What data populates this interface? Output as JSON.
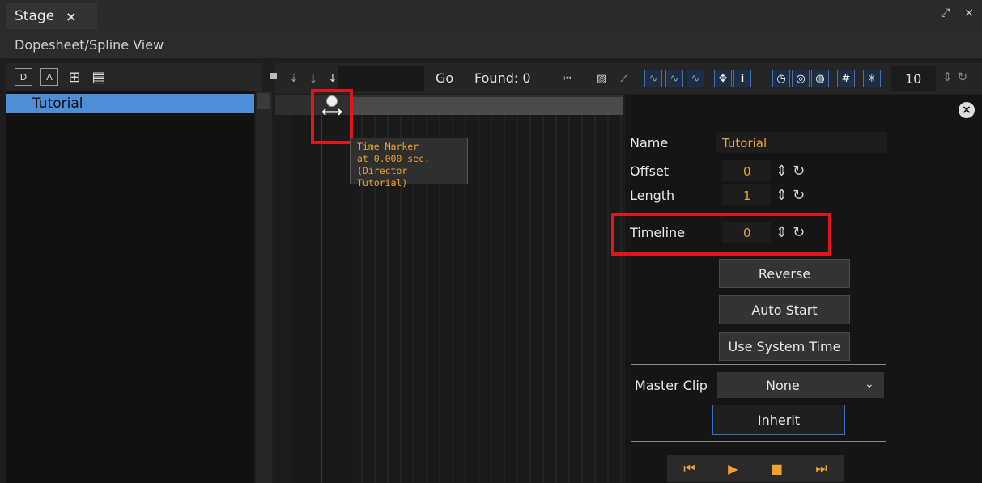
{
  "tabs": {
    "stage_label": "Stage",
    "close_label": "×"
  },
  "window_controls": {
    "maximize": "⤢",
    "close": "×"
  },
  "subtitle": "Dopesheet/Spline View",
  "left_toolbar": {
    "icons": [
      "new-director-icon",
      "new-actor-icon",
      "add-keyframe-icon",
      "save-icon"
    ]
  },
  "tree": {
    "items": [
      {
        "label": "Tutorial"
      }
    ]
  },
  "toolbar": {
    "go_label": "Go",
    "found_label": "Found: 0",
    "zoom_value": "10"
  },
  "tooltip": {
    "line1": "Time Marker",
    "line2": "at 0.000 sec.",
    "line3": "(Director Tutorial)"
  },
  "properties": {
    "name_label": "Name",
    "name_value": "Tutorial",
    "offset_label": "Offset",
    "offset_value": "0",
    "length_label": "Length",
    "length_value": "1",
    "timeline_label": "Timeline",
    "timeline_value": "0"
  },
  "buttons": {
    "reverse": "Reverse",
    "auto_start": "Auto Start",
    "use_system_time": "Use System Time",
    "inherit": "Inherit"
  },
  "master_clip": {
    "label": "Master Clip",
    "value": "None"
  },
  "colors": {
    "accent_orange": "#f0a030",
    "highlight_red": "#e0161e",
    "selection_blue": "#4d8ed6"
  }
}
